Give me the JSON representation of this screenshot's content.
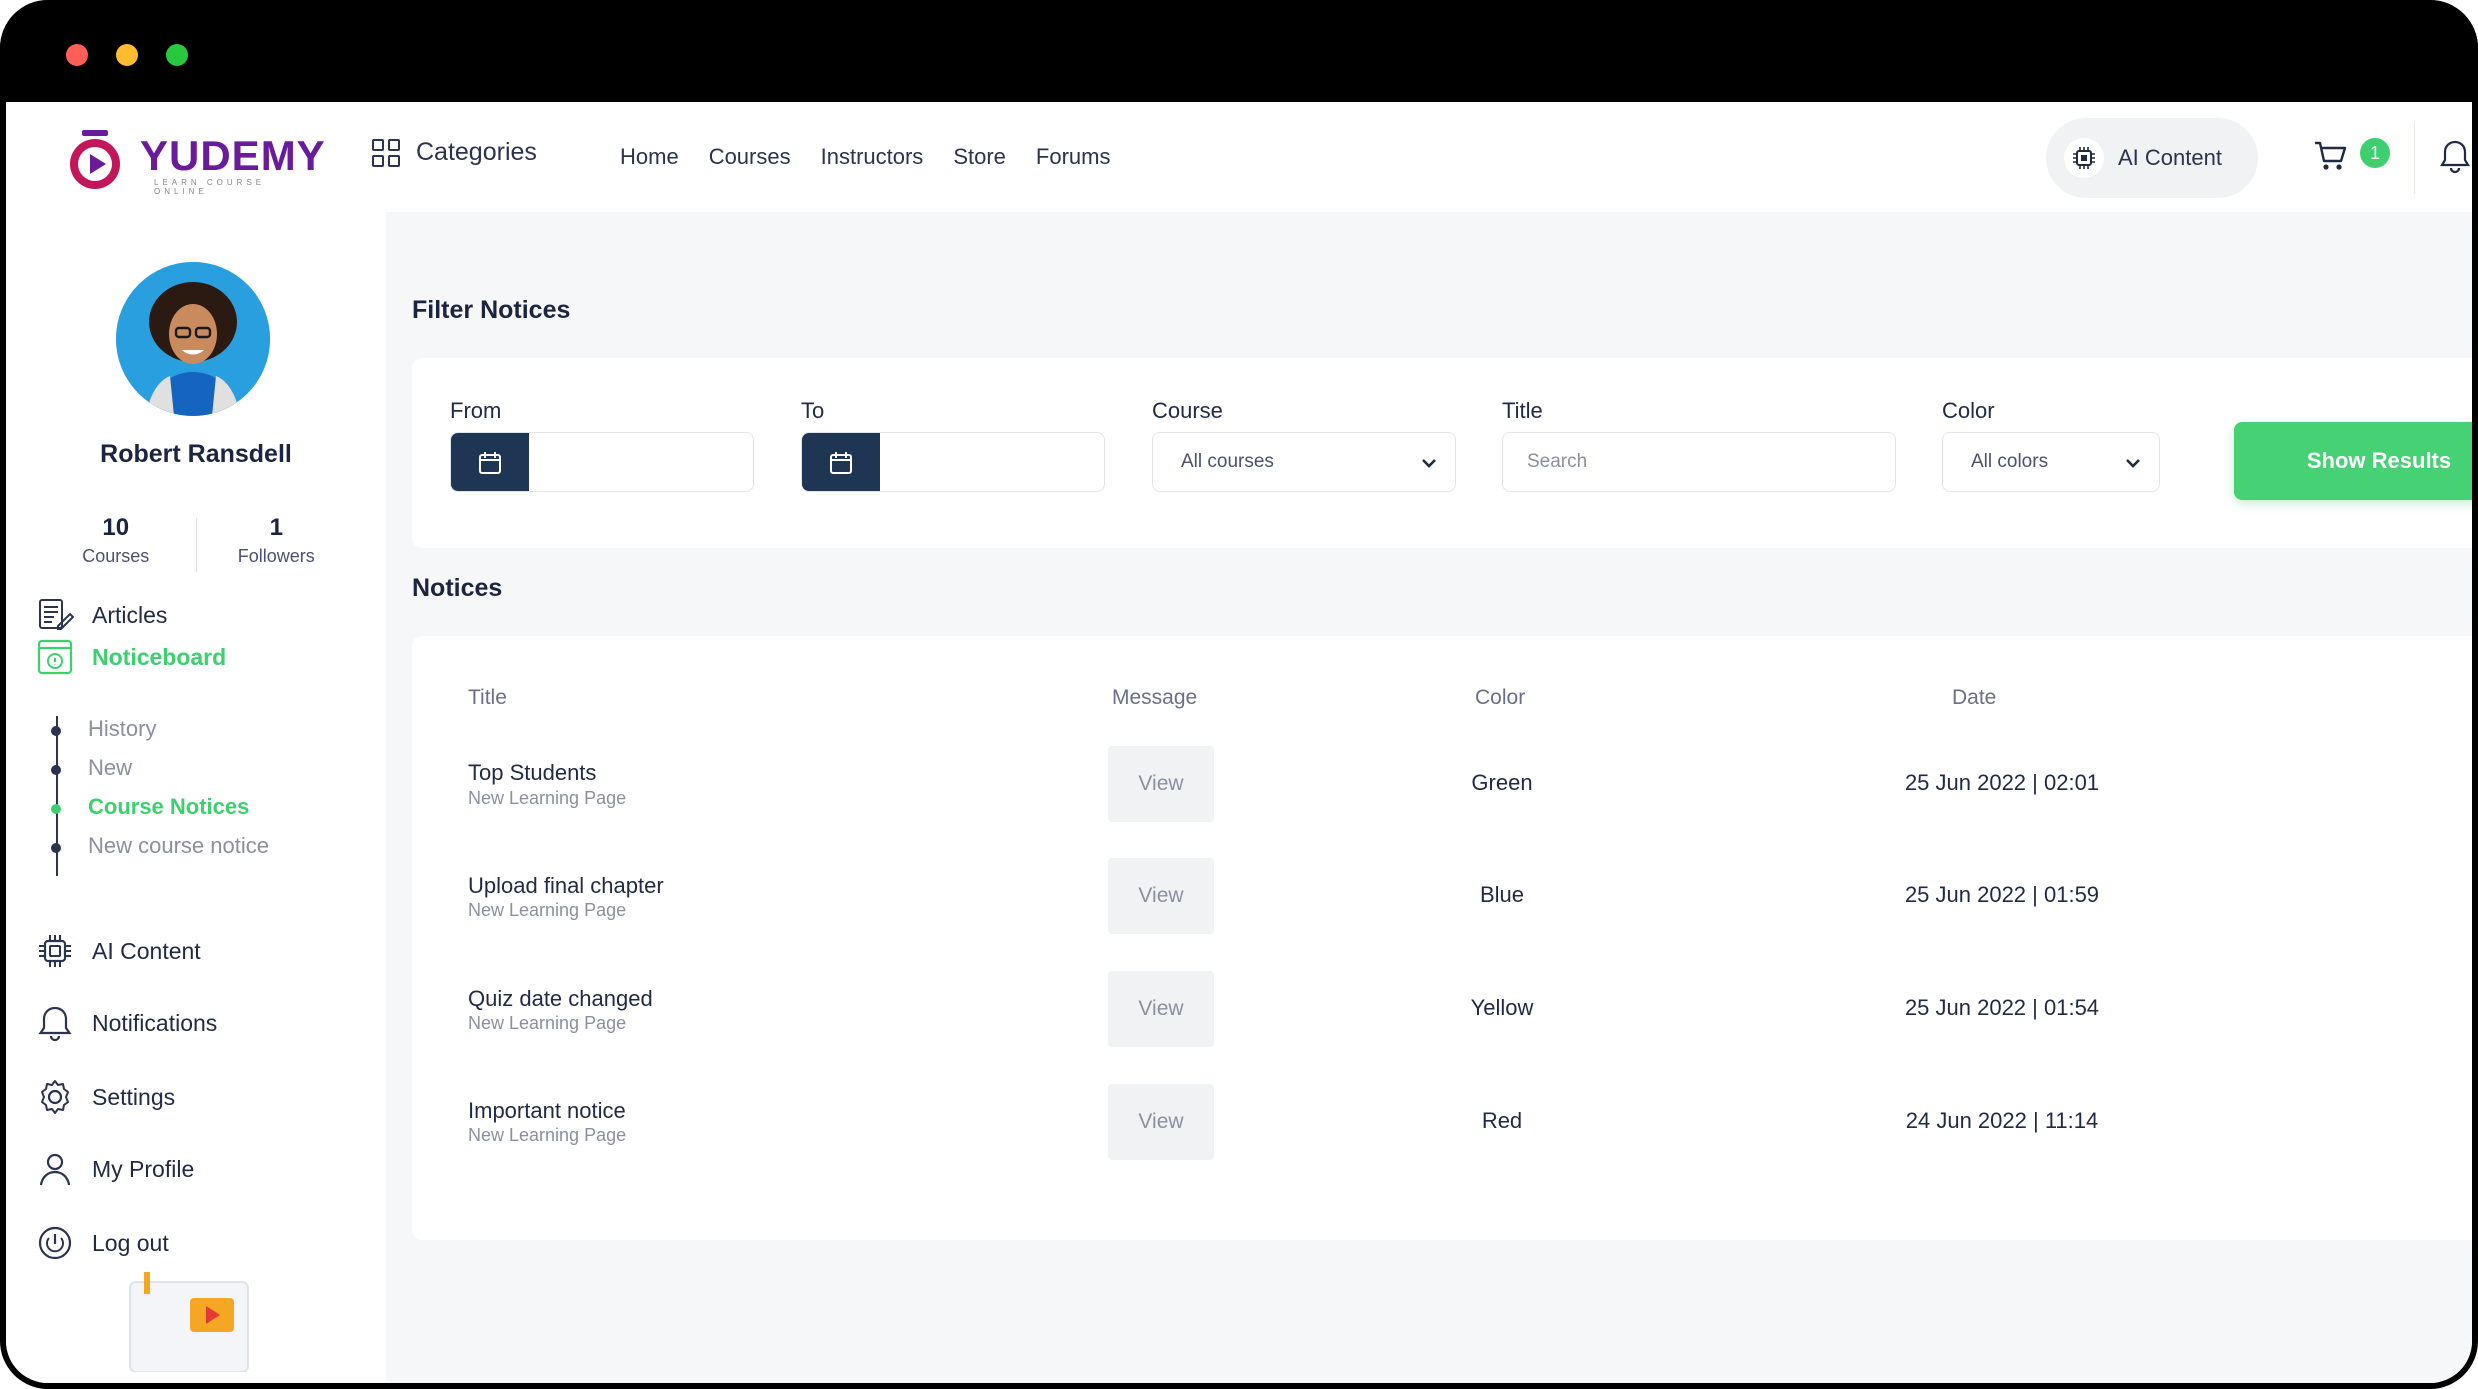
{
  "window": {
    "controls": [
      "close",
      "minimize",
      "maximize"
    ]
  },
  "header": {
    "logo_text": "YUDEMY",
    "logo_sub": "LEARN COURSE ONLINE",
    "categories_label": "Categories",
    "nav": [
      "Home",
      "Courses",
      "Instructors",
      "Store",
      "Forums"
    ],
    "ai_content_label": "AI Content",
    "cart_count": "1",
    "brand_color": "#6a1b9a",
    "accent_color": "#3ecf6f"
  },
  "sidebar": {
    "user_name": "Robert Ransdell",
    "stats": [
      {
        "num": "10",
        "label": "Courses"
      },
      {
        "num": "1",
        "label": "Followers"
      }
    ],
    "menu": {
      "articles": "Articles",
      "noticeboard": "Noticeboard",
      "ai_content": "AI Content",
      "notifications": "Notifications",
      "settings": "Settings",
      "my_profile": "My Profile",
      "log_out": "Log out"
    },
    "noticeboard_sub": [
      "History",
      "New",
      "Course Notices",
      "New course notice"
    ],
    "active_sub": "Course Notices"
  },
  "filter": {
    "title": "Filter Notices",
    "from_label": "From",
    "to_label": "To",
    "course_label": "Course",
    "course_value": "All courses",
    "title_label": "Title",
    "title_placeholder": "Search",
    "color_label": "Color",
    "color_value": "All colors",
    "show_results": "Show Results"
  },
  "notices": {
    "title": "Notices",
    "columns": [
      "Title",
      "Message",
      "Color",
      "Date"
    ],
    "view_label": "View",
    "rows": [
      {
        "title": "Top Students",
        "sub": "New Learning Page",
        "color": "Green",
        "date": "25 Jun 2022 | 02:01"
      },
      {
        "title": "Upload final chapter",
        "sub": "New Learning Page",
        "color": "Blue",
        "date": "25 Jun 2022 | 01:59"
      },
      {
        "title": "Quiz date changed",
        "sub": "New Learning Page",
        "color": "Yellow",
        "date": "25 Jun 2022 | 01:54"
      },
      {
        "title": "Important notice",
        "sub": "New Learning Page",
        "color": "Red",
        "date": "24 Jun 2022 | 11:14"
      }
    ]
  }
}
